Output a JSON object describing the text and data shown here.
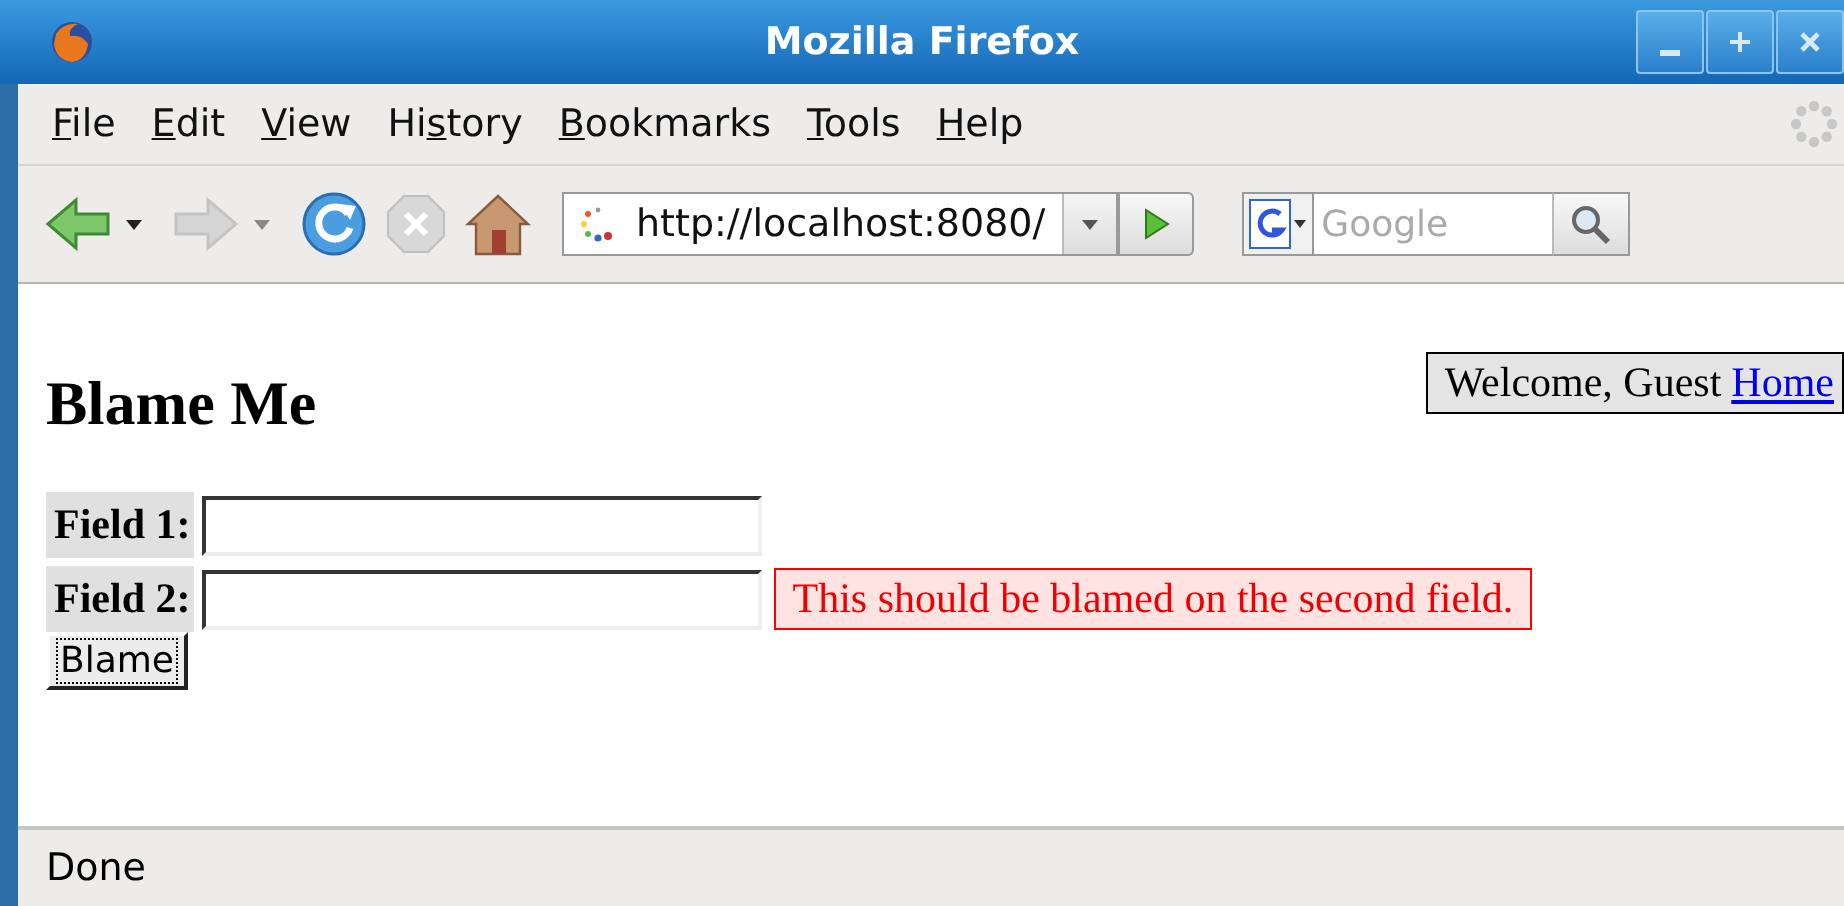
{
  "window": {
    "title": "Mozilla Firefox"
  },
  "menu": [
    {
      "key": "F",
      "after": "ile"
    },
    {
      "key": "E",
      "after": "dit"
    },
    {
      "key": "V",
      "after": "iew"
    },
    {
      "before": "Hi",
      "key": "s",
      "after": "tory"
    },
    {
      "key": "B",
      "after": "ookmarks"
    },
    {
      "key": "T",
      "after": "ools"
    },
    {
      "key": "H",
      "after": "elp"
    }
  ],
  "toolbar": {
    "back_disabled": false,
    "forward_disabled": true,
    "stop_disabled": true,
    "url": "http://localhost:8080/",
    "search_placeholder": "Google"
  },
  "page": {
    "heading": "Blame Me",
    "welcome": "Welcome, Guest",
    "home_link": "Home",
    "fields": [
      {
        "label": "Field 1:"
      },
      {
        "label": "Field 2:",
        "error": "This should be blamed on the second field."
      }
    ],
    "submit": "Blame"
  },
  "status_bar": "Done"
}
